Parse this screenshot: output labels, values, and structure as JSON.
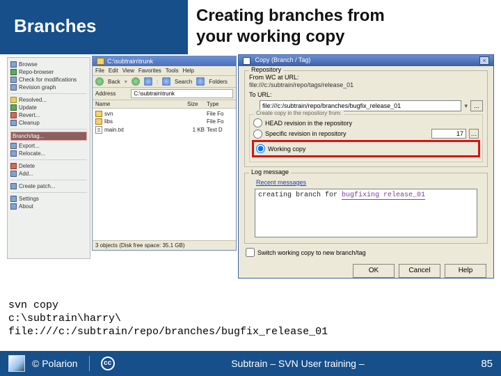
{
  "header": {
    "left_title": "Branches",
    "right_title_l1": "Creating branches from",
    "right_title_l2": "your working copy"
  },
  "tree": {
    "items_top": [
      "Browse",
      "Repo-browser",
      "Check for modifications",
      "Revision graph",
      "Resolved...",
      "Update",
      "Revert...",
      "Cleanup"
    ],
    "highlighted": "Branch/tag...",
    "items_mid": [
      "Export...",
      "Relocate...",
      "Delete",
      "Add..."
    ],
    "items_bot": [
      "Create patch...",
      "Settings",
      "About"
    ]
  },
  "explorer": {
    "title": "C:\\subtrain\\trunk",
    "menu": [
      "File",
      "Edit",
      "View",
      "Favorites",
      "Tools",
      "Help"
    ],
    "toolbar_back": "Back",
    "toolbar_search": "Search",
    "toolbar_folders": "Folders",
    "addr_label": "Address",
    "addr_value": "C:\\subtrain\\trunk",
    "cols": [
      "Name",
      "Size",
      "Type"
    ],
    "rows": [
      {
        "name": "svn",
        "size": "",
        "type": "File Fo"
      },
      {
        "name": "libs",
        "size": "",
        "type": "File Fo"
      },
      {
        "name": "main.txt",
        "size": "1 KB",
        "type": "Text D"
      }
    ],
    "status": "3 objects (Disk free space: 35.1 GB)"
  },
  "dialog": {
    "title": "Copy (Branch / Tag)",
    "grp_repo": "Repository",
    "from_label": "From WC at URL:",
    "from_value": "file:///c:/subtrain/repo/tags/release_01",
    "to_label": "To URL:",
    "to_value": "file:///c:/subtrain/repo/branches/bugfix_release_01",
    "to_btn": "...",
    "radio_head": "HEAD revision in the repository",
    "radio_spec": "Specific revision in repository",
    "spec_value": "17",
    "radio_wc": "Working copy",
    "grp_log": "Log message",
    "recent": "Recent messages",
    "log_prefix": "creating branch for ",
    "log_typing": "bugfixing release_01",
    "switch_cb": "Switch working copy to new branch/tag",
    "ok": "OK",
    "cancel": "Cancel",
    "help": "Help"
  },
  "cmd": "svn copy\nc:\\subtrain\\harry\\\nfile:///c:/subtrain/repo/branches/bugfix_release_01",
  "footer": {
    "copyright": "© Polarion",
    "cc": "cc",
    "center": "Subtrain – SVN User training –",
    "page": "85"
  }
}
